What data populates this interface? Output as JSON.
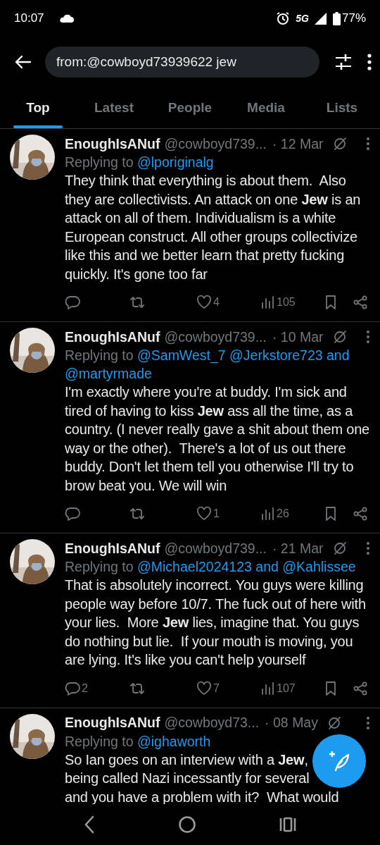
{
  "status_bar": {
    "time": "10:07",
    "network": "5G",
    "battery": "77%"
  },
  "search": {
    "value": "from:@cowboyd73939622 jew"
  },
  "tabs": [
    {
      "label": "Top",
      "selected": true
    },
    {
      "label": "Latest",
      "selected": false
    },
    {
      "label": "People",
      "selected": false
    },
    {
      "label": "Media",
      "selected": false
    },
    {
      "label": "Lists",
      "selected": false
    }
  ],
  "posts": [
    {
      "name": "EnoughIsANuf",
      "handle": "@cowboyd739...",
      "date": "· 12 Mar",
      "reply_label": "Replying to",
      "reply_to": {
        "mentions": [
          "@lporiginalg"
        ]
      },
      "body": "They think that everything is about them.  Also they are collectivists. An attack on one **Jew** is an attack on all of them. Individualism is a white European construct. All other groups collectivize like this and we better learn that pretty fucking quickly. It's gone too far",
      "likes": "4",
      "views": "105"
    },
    {
      "name": "EnoughIsANuf",
      "handle": "@cowboyd739...",
      "date": "· 10 Mar",
      "reply_label": "Replying to",
      "reply_to": {
        "mentions": [
          "@SamWest_7",
          "@Jerkstore723"
        ],
        "connector": "and",
        "last": "@martyrmade"
      },
      "body": "I'm exactly where you're at buddy. I'm sick and tired of having to kiss **Jew** ass all the time, as a country. (I never really gave a shit about them one way or the other).  There's a lot of us out there buddy. Don't let them tell you otherwise I'll try to brow beat you. We will win",
      "likes": "1",
      "views": "26"
    },
    {
      "name": "EnoughIsANuf",
      "handle": "@cowboyd739...",
      "date": "· 21 Mar",
      "reply_label": "Replying to",
      "reply_to": {
        "mentions": [
          "@Michael2024123"
        ],
        "connector": "and",
        "last": "@Kahlissee"
      },
      "body": "That is absolutely incorrect. You guys were killing people way before 10/7. The fuck out of here with your lies.  More **Jew** lies, imagine that. You guys do nothing but lie.  If your mouth is moving, you are lying. It's like you can't help yourself",
      "replies": "2",
      "likes": "7",
      "views": "107"
    },
    {
      "name": "EnoughIsANuf",
      "handle": "@cowboyd73...",
      "date": "· 08 May",
      "reply_label": "Replying to",
      "reply_to": {
        "mentions": [
          "@ighaworth"
        ]
      },
      "body_lines": [
        "So Ian goes on an interview with a **Jew**,",
        "being called Nazi incessantly for several",
        "and you have a problem with it?  What would"
      ]
    }
  ]
}
